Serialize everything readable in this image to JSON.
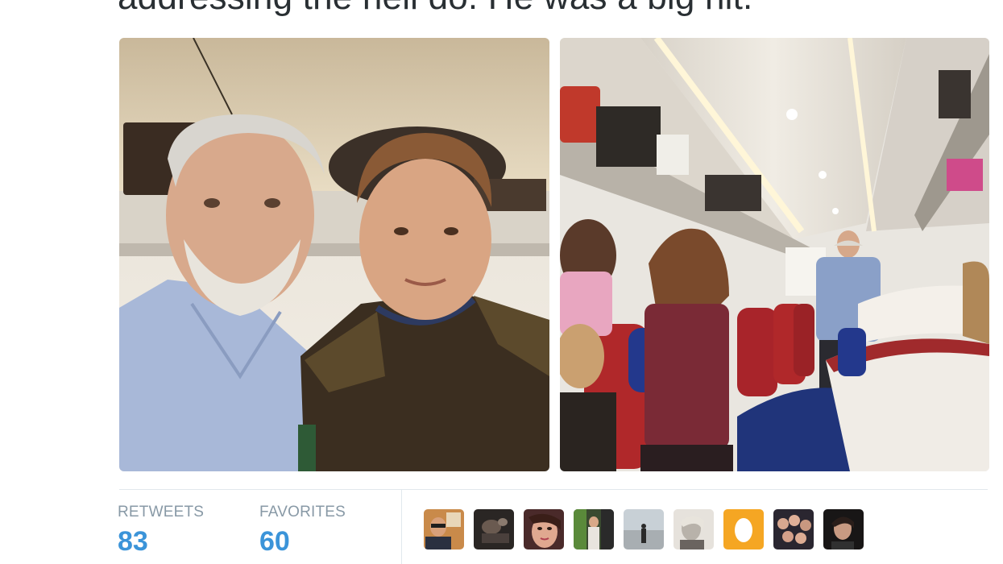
{
  "tweet": {
    "text_partial": "addressing the hеll do. He was a big hit."
  },
  "media": {
    "photos": [
      {
        "alt": "two-men-selfie-on-train"
      },
      {
        "alt": "man-addressing-train-carriage"
      }
    ]
  },
  "stats": {
    "retweets_label": "RETWEETS",
    "retweets_value": "83",
    "favorites_label": "FAVORITES",
    "favorites_value": "60"
  },
  "favoriters": [
    {
      "icon": "avatar-man-sunglasses"
    },
    {
      "icon": "avatar-dark-photo"
    },
    {
      "icon": "avatar-woman-closeup"
    },
    {
      "icon": "avatar-street-scene"
    },
    {
      "icon": "avatar-beach-figure"
    },
    {
      "icon": "avatar-bw-portrait"
    },
    {
      "icon": "avatar-default-egg"
    },
    {
      "icon": "avatar-group-photo"
    },
    {
      "icon": "avatar-dark-portrait"
    }
  ],
  "colors": {
    "accent": "#3b94d9",
    "label": "#8899a6",
    "text": "#292f33",
    "egg_bg": "#f5a623"
  }
}
